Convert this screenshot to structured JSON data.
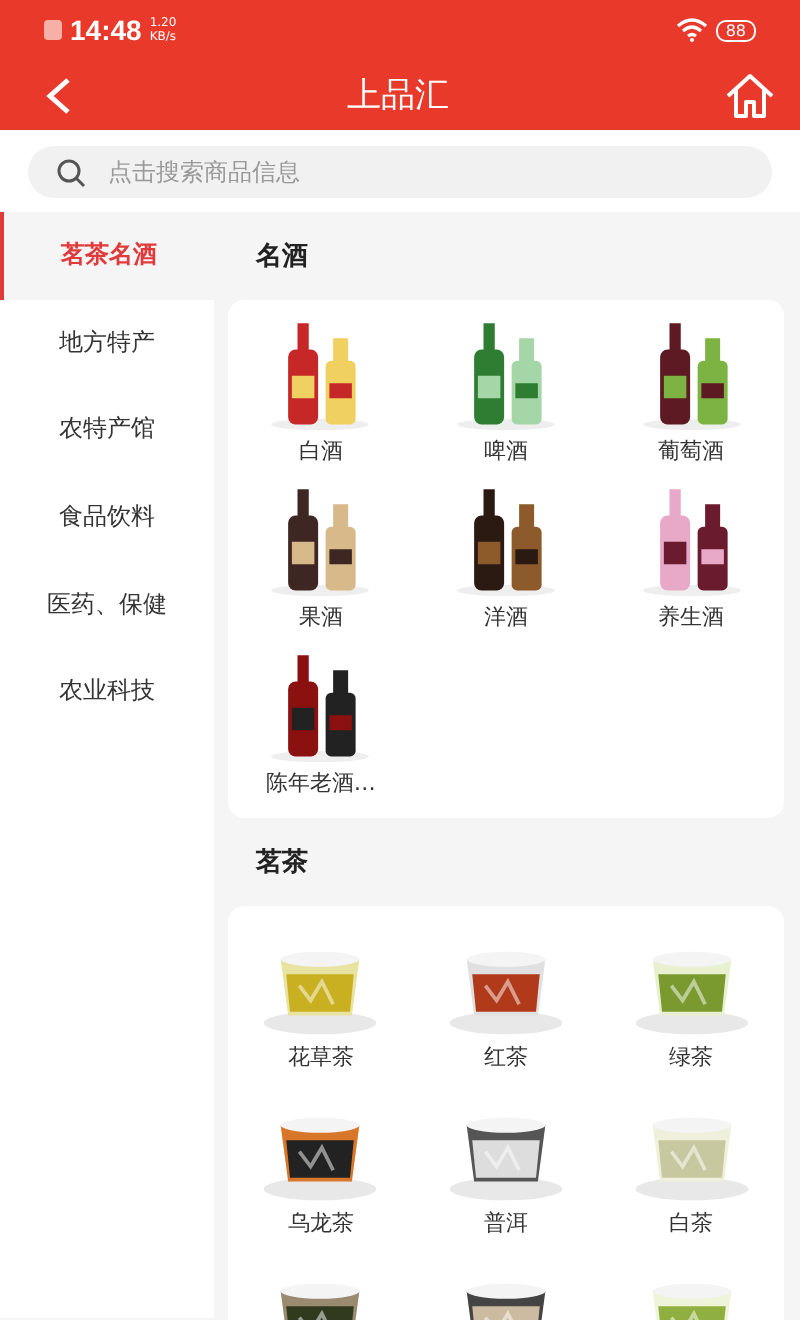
{
  "status_bar": {
    "time": "14:48",
    "speed": "1.20",
    "speed_unit": "KB/s",
    "battery": "88"
  },
  "header": {
    "title": "上品汇"
  },
  "search": {
    "placeholder": "点击搜索商品信息"
  },
  "sidebar": {
    "items": [
      {
        "label": "茗茶名酒",
        "selected": true
      },
      {
        "label": "地方特产",
        "selected": false
      },
      {
        "label": "农特产馆",
        "selected": false
      },
      {
        "label": "食品饮料",
        "selected": false
      },
      {
        "label": "医药、保健",
        "selected": false
      },
      {
        "label": "农业科技",
        "selected": false
      }
    ]
  },
  "sections": [
    {
      "title": "名酒",
      "items": [
        {
          "name": "白酒",
          "kind": "picture"
        },
        {
          "name": "啤酒",
          "kind": "picture"
        },
        {
          "name": "葡萄酒",
          "kind": "picture"
        },
        {
          "name": "果酒",
          "kind": "picture"
        },
        {
          "name": "洋酒",
          "kind": "picture"
        },
        {
          "name": "养生酒",
          "kind": "picture"
        },
        {
          "name": "陈年老酒…",
          "kind": "picture"
        }
      ]
    },
    {
      "title": "茗茶",
      "items": [
        {
          "name": "花草茶",
          "kind": "picture"
        },
        {
          "name": "红茶",
          "kind": "picture"
        },
        {
          "name": "绿茶",
          "kind": "picture"
        },
        {
          "name": "乌龙茶",
          "kind": "picture"
        },
        {
          "name": "普洱",
          "kind": "picture"
        },
        {
          "name": "白茶",
          "kind": "picture"
        },
        {
          "kind": "picture"
        },
        {
          "kind": "picture"
        },
        {
          "kind": "picture"
        }
      ]
    }
  ]
}
